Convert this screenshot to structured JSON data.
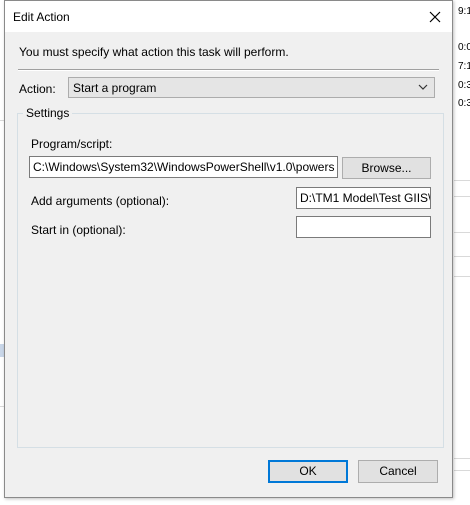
{
  "background": {
    "right_texts": [
      "9:1",
      "0:0",
      "7:1",
      "0:3",
      "0:3"
    ]
  },
  "dialog": {
    "title": "Edit Action",
    "info_text": "You must specify what action this task will perform.",
    "action_label": "Action:",
    "action_value": "Start a program",
    "settings_label": "Settings",
    "program_label": "Program/script:",
    "program_value": "C:\\Windows\\System32\\WindowsPowerShell\\v1.0\\powers",
    "browse_label": "Browse...",
    "arguments_label": "Add arguments (optional):",
    "arguments_value": "D:\\TM1 Model\\Test GIIS\\",
    "startin_label": "Start in (optional):",
    "startin_value": "",
    "ok_label": "OK",
    "cancel_label": "Cancel"
  },
  "icons": {
    "close": "close-icon",
    "dropdown": "chevron-down-icon"
  }
}
